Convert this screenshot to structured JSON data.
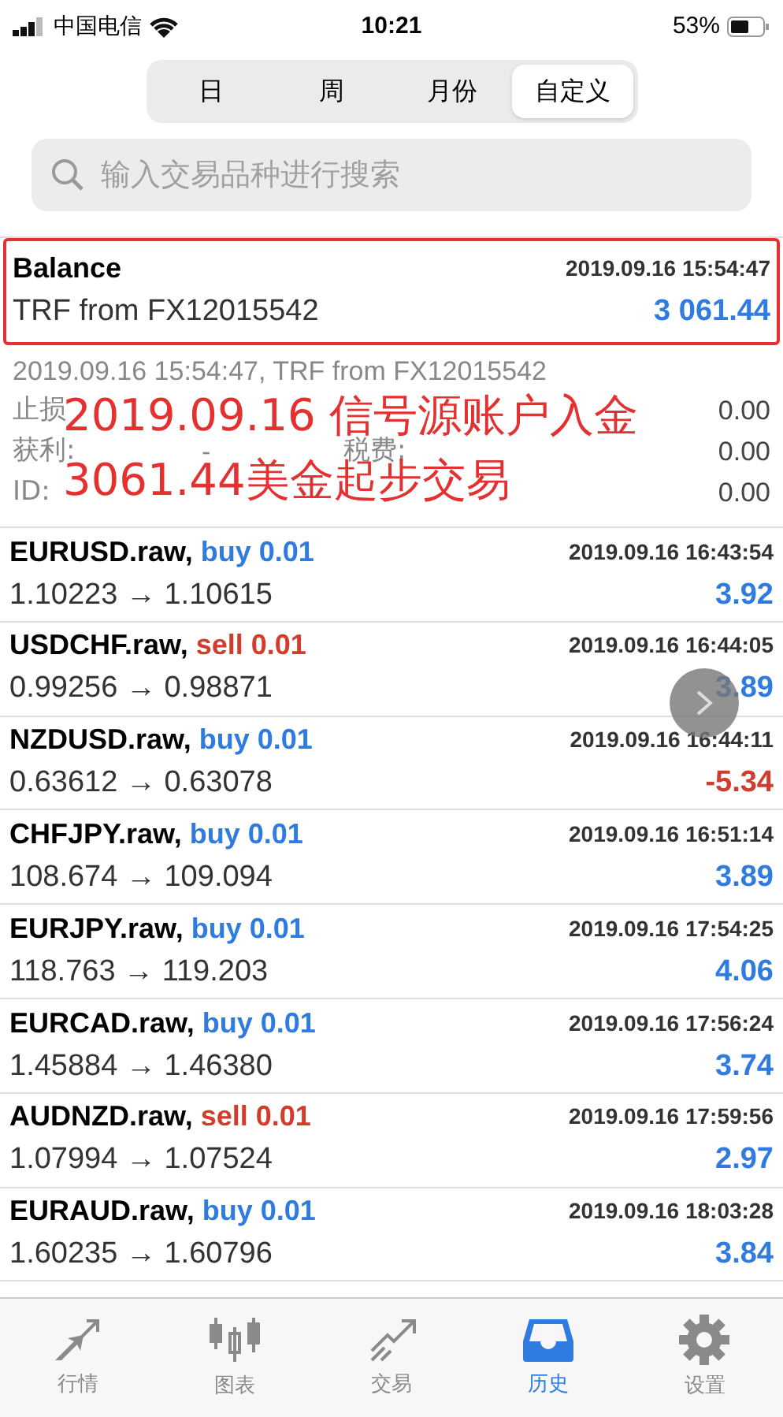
{
  "status_bar": {
    "carrier": "中国电信",
    "time": "10:21",
    "battery": "53%"
  },
  "segments": [
    {
      "label": "日",
      "selected": false
    },
    {
      "label": "周",
      "selected": false
    },
    {
      "label": "月份",
      "selected": false
    },
    {
      "label": "自定义",
      "selected": true
    }
  ],
  "search": {
    "placeholder": "输入交易品种进行搜索"
  },
  "balance": {
    "title": "Balance",
    "time": "2019.09.16 15:54:47",
    "comment": "TRF from FX12015542",
    "amount": "3 061.44"
  },
  "details": {
    "summary": "2019.09.16 15:54:47, TRF from FX12015542",
    "rows": [
      {
        "label": "止损",
        "value": "0.00"
      },
      {
        "label": "获利:",
        "middle": "-",
        "label_2": "税费:",
        "value": "0.00"
      },
      {
        "label": "ID:",
        "value": "0.00"
      }
    ]
  },
  "annotation": {
    "lines": [
      "2019.09.16 信号源账户入金",
      "3061.44美金起步交易"
    ]
  },
  "trades": [
    {
      "symbol": "EURUSD.raw,",
      "volume": {
        "text": "buy 0.01",
        "color": "#2f7be0"
      },
      "time": "2019.09.16 16:43:54",
      "prices": "1.10223 → 1.10615",
      "profit": {
        "text": "3.92",
        "color": "#2f7be0"
      }
    },
    {
      "symbol": "USDCHF.raw,",
      "volume": {
        "text": "sell 0.01",
        "color": "#d23c2c"
      },
      "time": "2019.09.16 16:44:05",
      "prices": "0.99256 → 0.98871",
      "profit": {
        "text": "3.89",
        "color": "#2f7be0"
      }
    },
    {
      "symbol": "NZDUSD.raw,",
      "volume": {
        "text": "buy 0.01",
        "color": "#2f7be0"
      },
      "time": "2019.09.16 16:44:11",
      "prices": "0.63612 → 0.63078",
      "profit": {
        "text": "-5.34",
        "color": "#d23c2c"
      }
    },
    {
      "symbol": "CHFJPY.raw,",
      "volume": {
        "text": "buy 0.01",
        "color": "#2f7be0"
      },
      "time": "2019.09.16 16:51:14",
      "prices": "108.674 → 109.094",
      "profit": {
        "text": "3.89",
        "color": "#2f7be0"
      }
    },
    {
      "symbol": "EURJPY.raw,",
      "volume": {
        "text": "buy 0.01",
        "color": "#2f7be0"
      },
      "time": "2019.09.16 17:54:25",
      "prices": "118.763 → 119.203",
      "profit": {
        "text": "4.06",
        "color": "#2f7be0"
      }
    },
    {
      "symbol": "EURCAD.raw,",
      "volume": {
        "text": "buy 0.01",
        "color": "#2f7be0"
      },
      "time": "2019.09.16 17:56:24",
      "prices": "1.45884 → 1.46380",
      "profit": {
        "text": "3.74",
        "color": "#2f7be0"
      }
    },
    {
      "symbol": "AUDNZD.raw,",
      "volume": {
        "text": "sell 0.01",
        "color": "#d23c2c"
      },
      "time": "2019.09.16 17:59:56",
      "prices": "1.07994 → 1.07524",
      "profit": {
        "text": "2.97",
        "color": "#2f7be0"
      }
    },
    {
      "symbol": "EURAUD.raw,",
      "volume": {
        "text": "buy 0.01",
        "color": "#2f7be0"
      },
      "time": "2019.09.16 18:03:28",
      "prices": "1.60235 → 1.60796",
      "profit": {
        "text": "3.84",
        "color": "#2f7be0"
      }
    }
  ],
  "tab_bar": [
    {
      "label": "行情",
      "kind": "quotes",
      "selected": false
    },
    {
      "label": "图表",
      "kind": "chart",
      "selected": false
    },
    {
      "label": "交易",
      "kind": "trade",
      "selected": false
    },
    {
      "label": "历史",
      "kind": "history",
      "selected": true
    },
    {
      "label": "设置",
      "kind": "settings",
      "selected": false
    }
  ]
}
